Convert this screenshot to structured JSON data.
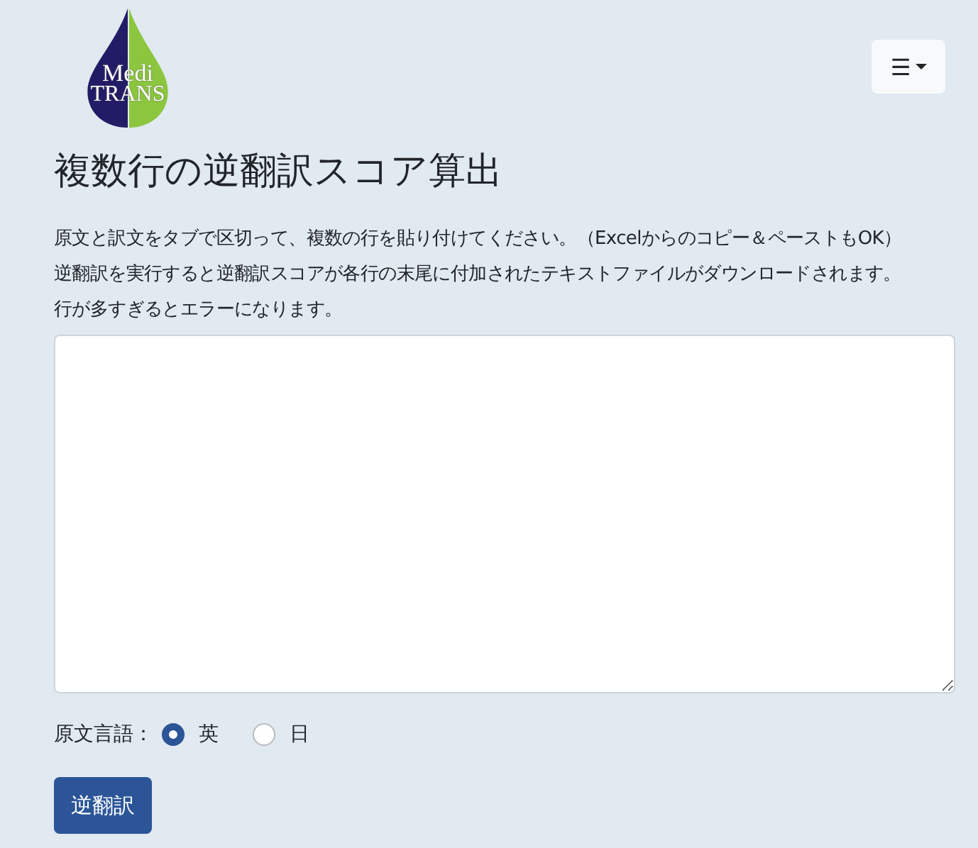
{
  "logo": {
    "line1": "Medi",
    "line2": "TRANS"
  },
  "menu_button": {
    "icon": "☰"
  },
  "title": "複数行の逆翻訳スコア算出",
  "instructions": [
    "原文と訳文をタブで区切って、複数の行を貼り付けてください。（Excelからのコピー＆ペーストもOK）",
    "逆翻訳を実行すると逆翻訳スコアが各行の末尾に付加されたテキストファイルがダウンロードされます。",
    "行が多すぎるとエラーになります。"
  ],
  "source_language": {
    "label": "原文言語：",
    "options": [
      {
        "label": "英",
        "selected": true
      },
      {
        "label": "日",
        "selected": false
      }
    ]
  },
  "submit_button": "逆翻訳"
}
